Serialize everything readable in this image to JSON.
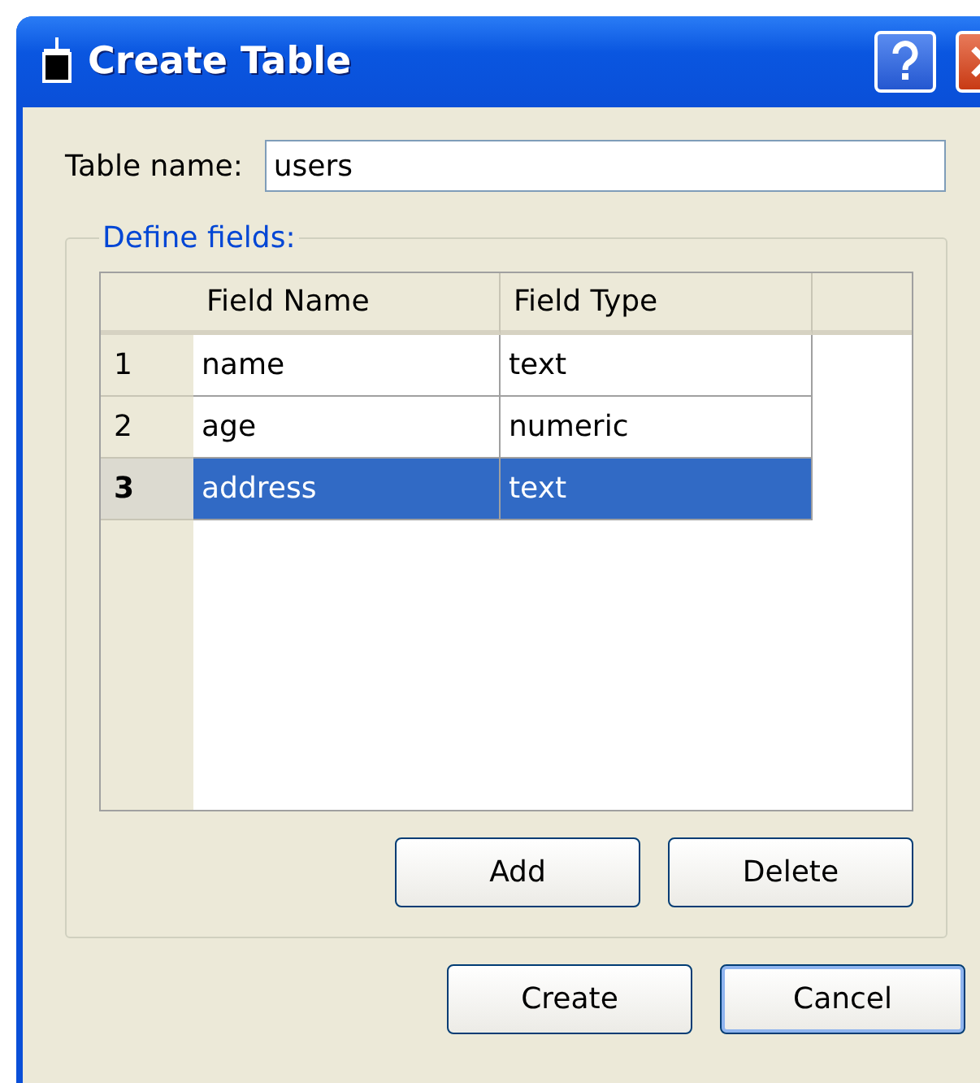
{
  "window": {
    "title": "Create Table"
  },
  "table_name": {
    "label": "Table name:",
    "value": "users"
  },
  "fields_group": {
    "legend": "Define fields:",
    "columns": [
      "Field Name",
      "Field Type"
    ],
    "rows": [
      {
        "number": "1",
        "name": "name",
        "type": "text",
        "selected": false
      },
      {
        "number": "2",
        "name": "age",
        "type": "numeric",
        "selected": false
      },
      {
        "number": "3",
        "name": "address",
        "type": "text",
        "selected": true
      }
    ],
    "buttons": [
      "Add",
      "Delete"
    ]
  },
  "buttons": [
    {
      "label": "Create",
      "default": false
    },
    {
      "label": "Cancel",
      "default": true
    }
  ]
}
